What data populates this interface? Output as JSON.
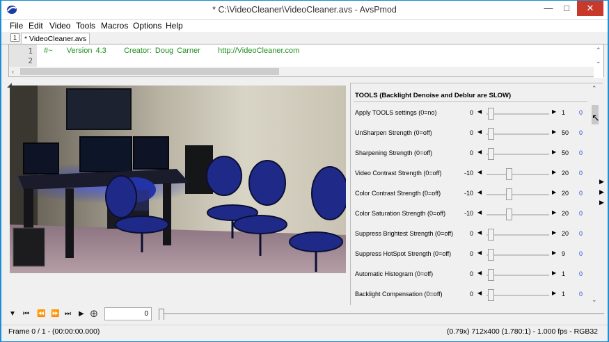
{
  "window": {
    "title": "* C:\\VideoCleaner\\VideoCleaner.avs - AvsPmod"
  },
  "menu": [
    "File",
    "Edit",
    "Video",
    "Tools",
    "Macros",
    "Options",
    "Help"
  ],
  "tab": {
    "number": "1",
    "label": "* VideoCleaner.avs"
  },
  "editor": {
    "lines": [
      {
        "num": "1",
        "text": "#~    Version 4.3     Creator: Doug Carner     http://VideoCleaner.com"
      },
      {
        "num": "2",
        "text": ""
      }
    ]
  },
  "tools": {
    "title": "TOOLS (Backlight Denoise and Deblur are SLOW)",
    "rows": [
      {
        "label": "Apply TOOLS settings (0=no)",
        "min": "0",
        "max": "1",
        "value": "0",
        "level": 0.0
      },
      {
        "label": "UnSharpen Strength (0=off)",
        "min": "0",
        "max": "50",
        "value": "0",
        "level": 0.0
      },
      {
        "label": "Sharpening Strength (0=off)",
        "min": "0",
        "max": "50",
        "value": "0",
        "level": 0.0
      },
      {
        "label": "Video Contrast Strength (0=off)",
        "min": "-10",
        "max": "20",
        "value": "0",
        "level": 0.333
      },
      {
        "label": "Color Contrast Strength (0=off)",
        "min": "-10",
        "max": "20",
        "value": "0",
        "level": 0.333
      },
      {
        "label": "Color Saturation Strength (0=off)",
        "min": "-10",
        "max": "20",
        "value": "0",
        "level": 0.333
      },
      {
        "label": "Suppress Brightest Strength (0=off)",
        "min": "0",
        "max": "20",
        "value": "0",
        "level": 0.0
      },
      {
        "label": "Suppress HotSpot Strength (0=off)",
        "min": "0",
        "max": "9",
        "value": "0",
        "level": 0.0
      },
      {
        "label": "Automatic Histogram (0=off)",
        "min": "0",
        "max": "1",
        "value": "0",
        "level": 0.0
      },
      {
        "label": "Backlight Compensation (0=off)",
        "min": "0",
        "max": "1",
        "value": "0",
        "level": 0.0
      }
    ]
  },
  "controls": {
    "frame_value": "0"
  },
  "status": {
    "left": "Frame 0 / 1  -  (00:00:00.000)",
    "right": "(0.79x)  712x400 (1.780:1)  -  1.000 fps  -  RGB32"
  },
  "icons": {
    "app": "avspmod-icon",
    "play_controls": [
      "dropdown-triangle-icon",
      "skip-to-start-icon",
      "step-back-icon",
      "step-forward-icon",
      "skip-to-end-icon",
      "play-icon",
      "crop-icon"
    ]
  }
}
